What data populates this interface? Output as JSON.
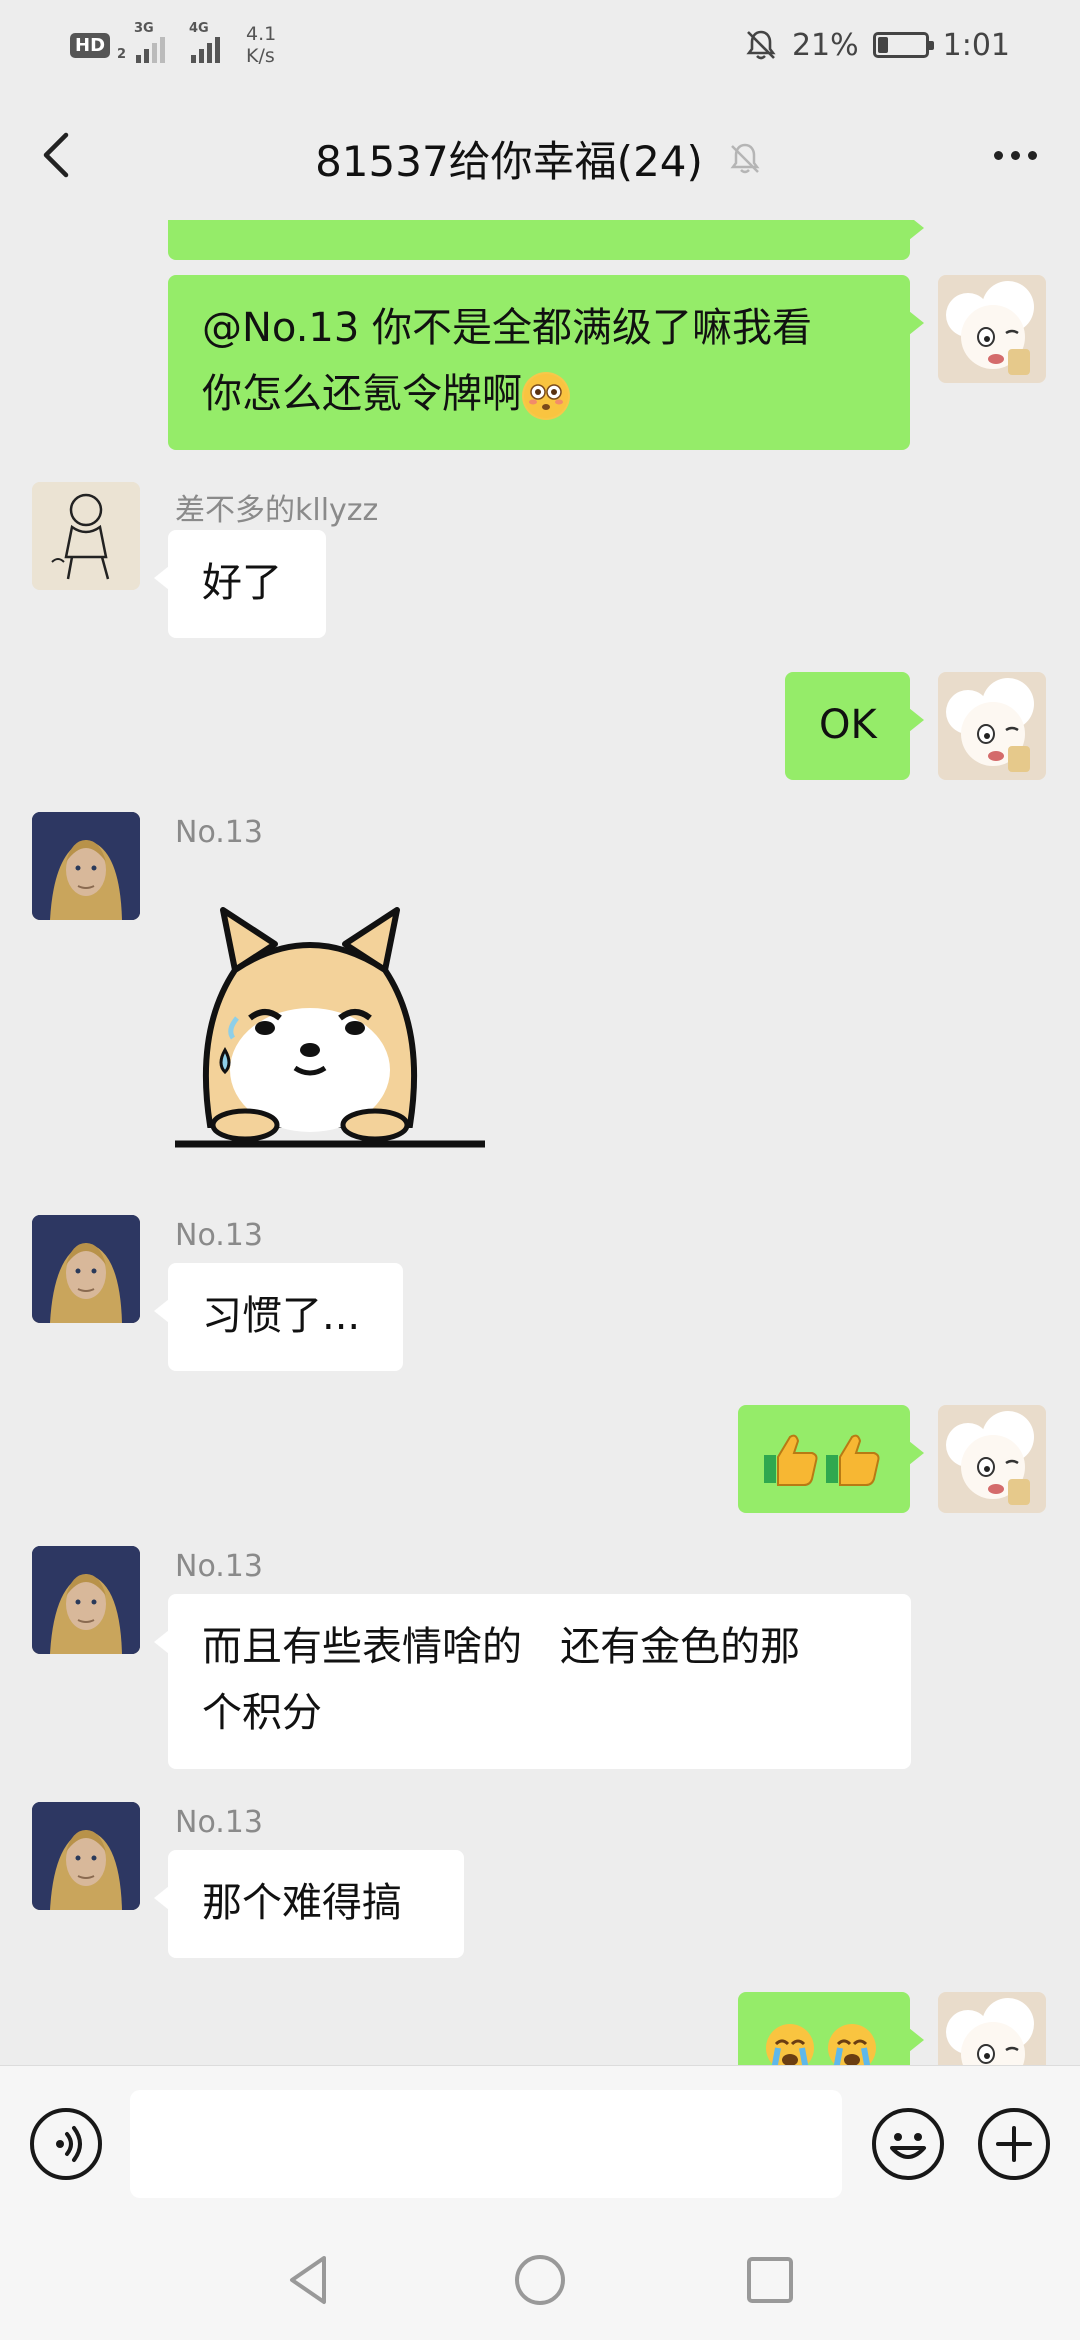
{
  "status_bar": {
    "hd_label": "HD",
    "hd_sub": "2",
    "sim1_label": "3G",
    "sim2_label": "4G",
    "net_speed_value": "4.1",
    "net_speed_unit": "K/s",
    "battery_text": "21%",
    "battery_level": 0.21,
    "time": "1:01"
  },
  "header": {
    "title": "81537给你幸福(24)",
    "muted_icon": "bell-off-icon",
    "back_icon": "chevron-left-icon",
    "more_icon": "more-dots-icon"
  },
  "messages": [
    {
      "side": "me",
      "text": "",
      "note": "partial bubble cut off at top"
    },
    {
      "side": "me",
      "line1": "@No.13  你不是全都满级了嘛我看",
      "line2": "你怎么还氪令牌啊",
      "emoji": "flushed-face-emoji"
    },
    {
      "side": "other",
      "sender": "差不多的kllyzz",
      "text": "好了"
    },
    {
      "side": "me",
      "text": "OK"
    },
    {
      "side": "other",
      "sender": "No.13",
      "sticker": "shiba-dog-sweat-sticker"
    },
    {
      "side": "other",
      "sender": "No.13",
      "text": "习惯了..."
    },
    {
      "side": "me",
      "emoji": "thumbs-up-emoji"
    },
    {
      "side": "other",
      "sender": "No.13",
      "line1": "而且有些表情啥的   还有金色的那",
      "line2": "个积分"
    },
    {
      "side": "other",
      "sender": "No.13",
      "text": "那个难得搞"
    },
    {
      "side": "me",
      "emoji": "crying-face-emoji"
    }
  ],
  "input_bar": {
    "voice_icon": "voice-icon",
    "emoji_icon": "smiley-icon",
    "plus_icon": "plus-icon",
    "text_value": ""
  },
  "nav_bar": {
    "back_icon": "nav-back-triangle-icon",
    "home_icon": "nav-home-circle-icon",
    "recent_icon": "nav-recent-square-icon"
  },
  "colors": {
    "background": "#ededed",
    "my_bubble": "#95ec69",
    "other_bubble": "#ffffff"
  }
}
